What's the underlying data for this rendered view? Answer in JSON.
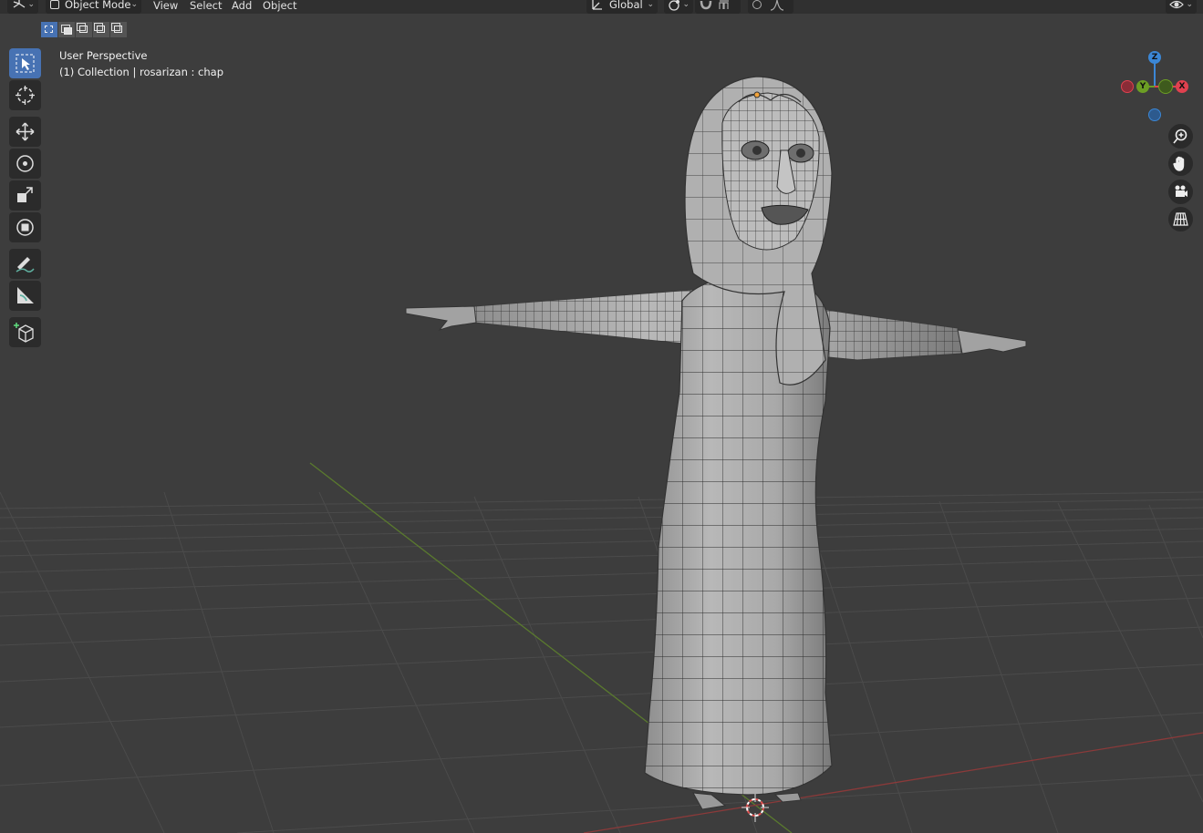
{
  "header": {
    "editor_type_icon": "3d-viewport-icon",
    "mode_label": "Object Mode",
    "menus": [
      "View",
      "Select",
      "Add",
      "Object"
    ],
    "orientation_label": "Global"
  },
  "viewport": {
    "view_name": "User Perspective",
    "collection_info": "(1) Collection | rosarizan : chap"
  },
  "toolbar": {
    "tools": [
      "select-box-icon",
      "cursor-icon",
      "move-icon",
      "rotate-icon",
      "scale-icon",
      "transform-icon",
      "annotate-icon",
      "measure-icon",
      "add-cube-icon"
    ],
    "active_tool": "select-box-icon"
  },
  "gizmo": {
    "axes": [
      "Z",
      "Y",
      "X"
    ],
    "colors": {
      "x": "#e0414f",
      "y": "#6c9e24",
      "z": "#3b87d6"
    }
  },
  "colors": {
    "background": "#3d3d3d",
    "header": "#303030",
    "accent": "#4772b3",
    "grid": "#505050"
  }
}
